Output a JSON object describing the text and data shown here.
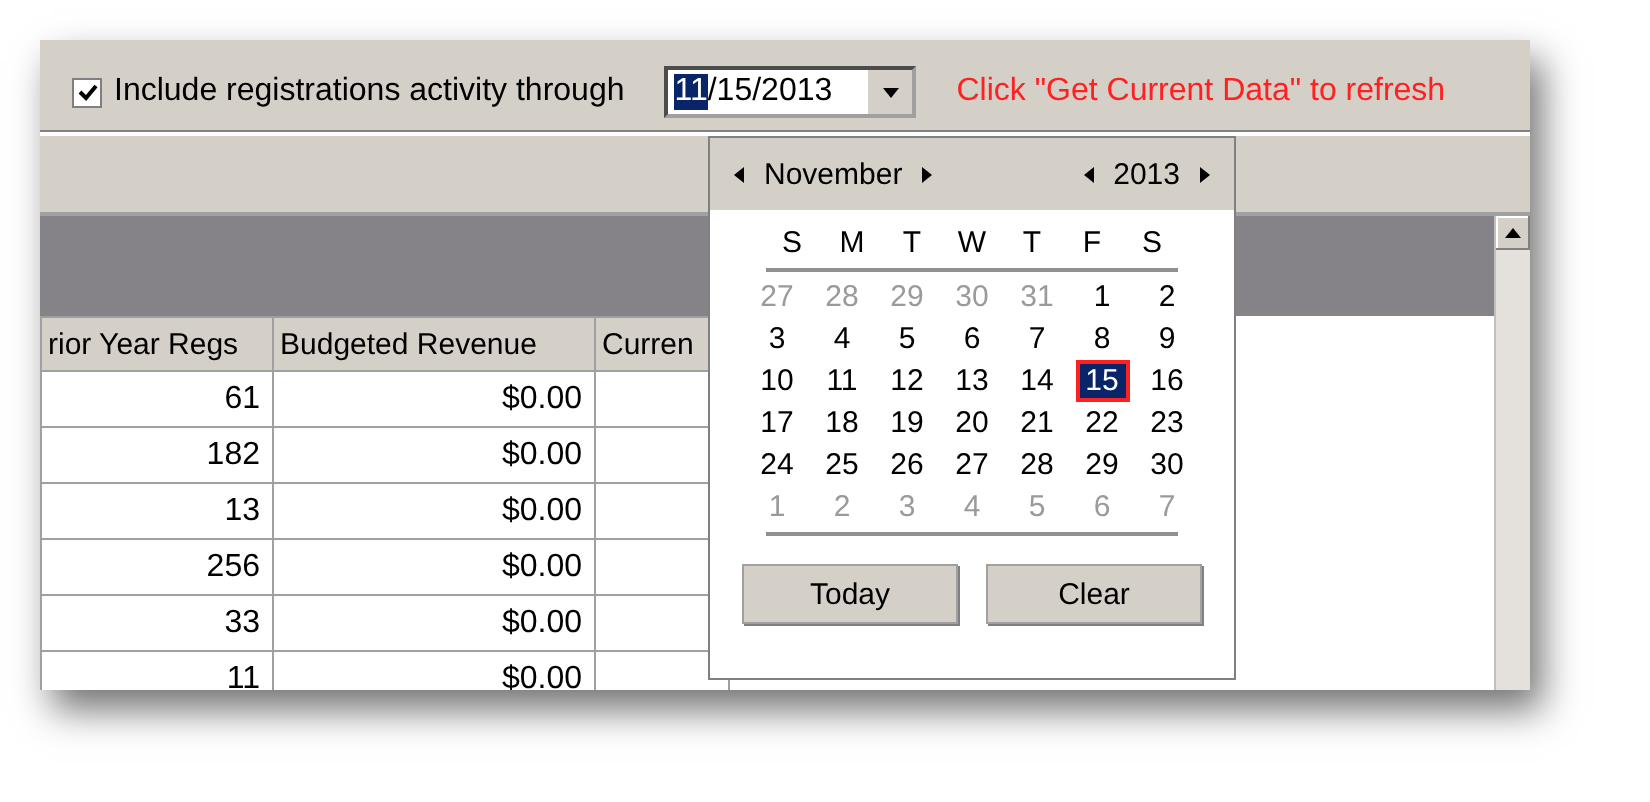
{
  "toolbar": {
    "include_checkbox": {
      "label": "Include registrations activity through",
      "checked": true
    },
    "date_field": {
      "segments": [
        {
          "text": "11",
          "selected": true
        },
        {
          "text": "/15/2013",
          "selected": false
        }
      ]
    },
    "hint": "Click \"Get Current Data\" to refresh"
  },
  "table": {
    "columns": [
      "rior Year Regs",
      "Budgeted Revenue",
      "Curren"
    ],
    "rows": [
      [
        "61",
        "$0.00"
      ],
      [
        "182",
        "$0.00"
      ],
      [
        "13",
        "$0.00"
      ],
      [
        "256",
        "$0.00"
      ],
      [
        "33",
        "$0.00"
      ],
      [
        "11",
        "$0.00"
      ]
    ]
  },
  "calendar": {
    "month": "November",
    "year": "2013",
    "weekdays": [
      "S",
      "M",
      "T",
      "W",
      "T",
      "F",
      "S"
    ],
    "weeks": [
      [
        {
          "day": "27",
          "other_month": true,
          "selected": false
        },
        {
          "day": "28",
          "other_month": true,
          "selected": false
        },
        {
          "day": "29",
          "other_month": true,
          "selected": false
        },
        {
          "day": "30",
          "other_month": true,
          "selected": false
        },
        {
          "day": "31",
          "other_month": true,
          "selected": false
        },
        {
          "day": "1",
          "other_month": false,
          "selected": false
        },
        {
          "day": "2",
          "other_month": false,
          "selected": false
        }
      ],
      [
        {
          "day": "3",
          "other_month": false,
          "selected": false
        },
        {
          "day": "4",
          "other_month": false,
          "selected": false
        },
        {
          "day": "5",
          "other_month": false,
          "selected": false
        },
        {
          "day": "6",
          "other_month": false,
          "selected": false
        },
        {
          "day": "7",
          "other_month": false,
          "selected": false
        },
        {
          "day": "8",
          "other_month": false,
          "selected": false
        },
        {
          "day": "9",
          "other_month": false,
          "selected": false
        }
      ],
      [
        {
          "day": "10",
          "other_month": false,
          "selected": false
        },
        {
          "day": "11",
          "other_month": false,
          "selected": false
        },
        {
          "day": "12",
          "other_month": false,
          "selected": false
        },
        {
          "day": "13",
          "other_month": false,
          "selected": false
        },
        {
          "day": "14",
          "other_month": false,
          "selected": false
        },
        {
          "day": "15",
          "other_month": false,
          "selected": true
        },
        {
          "day": "16",
          "other_month": false,
          "selected": false
        }
      ],
      [
        {
          "day": "17",
          "other_month": false,
          "selected": false
        },
        {
          "day": "18",
          "other_month": false,
          "selected": false
        },
        {
          "day": "19",
          "other_month": false,
          "selected": false
        },
        {
          "day": "20",
          "other_month": false,
          "selected": false
        },
        {
          "day": "21",
          "other_month": false,
          "selected": false
        },
        {
          "day": "22",
          "other_month": false,
          "selected": false
        },
        {
          "day": "23",
          "other_month": false,
          "selected": false
        }
      ],
      [
        {
          "day": "24",
          "other_month": false,
          "selected": false
        },
        {
          "day": "25",
          "other_month": false,
          "selected": false
        },
        {
          "day": "26",
          "other_month": false,
          "selected": false
        },
        {
          "day": "27",
          "other_month": false,
          "selected": false
        },
        {
          "day": "28",
          "other_month": false,
          "selected": false
        },
        {
          "day": "29",
          "other_month": false,
          "selected": false
        },
        {
          "day": "30",
          "other_month": false,
          "selected": false
        }
      ],
      [
        {
          "day": "1",
          "other_month": true,
          "selected": false
        },
        {
          "day": "2",
          "other_month": true,
          "selected": false
        },
        {
          "day": "3",
          "other_month": true,
          "selected": false
        },
        {
          "day": "4",
          "other_month": true,
          "selected": false
        },
        {
          "day": "5",
          "other_month": true,
          "selected": false
        },
        {
          "day": "6",
          "other_month": true,
          "selected": false
        },
        {
          "day": "7",
          "other_month": true,
          "selected": false
        }
      ]
    ],
    "buttons": [
      "Today",
      "Clear"
    ]
  }
}
